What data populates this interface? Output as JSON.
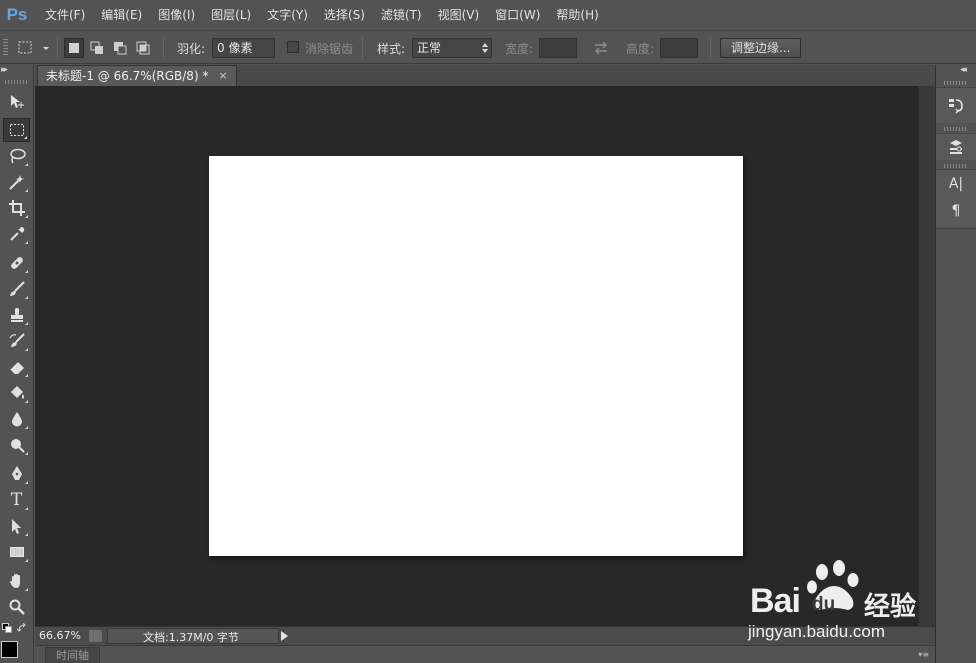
{
  "app": {
    "logo": "Ps"
  },
  "menu": [
    "文件(F)",
    "编辑(E)",
    "图像(I)",
    "图层(L)",
    "文字(Y)",
    "选择(S)",
    "滤镜(T)",
    "视图(V)",
    "窗口(W)",
    "帮助(H)"
  ],
  "options": {
    "feather_label": "羽化:",
    "feather_value": "0 像素",
    "antialias_label": "消除锯齿",
    "style_label": "样式:",
    "style_value": "正常",
    "width_label": "宽度:",
    "height_label": "高度:",
    "refine_button": "调整边缘..."
  },
  "document": {
    "tab_title": "未标题-1 @ 66.7%(RGB/8) *",
    "close_glyph": "×"
  },
  "status": {
    "zoom": "66.67%",
    "doc_info": "文档:1.37M/0 字节"
  },
  "timeline": {
    "tab_label": "时间轴"
  },
  "right_panel": {
    "type_icon_label": "A|",
    "paragraph_icon_label": "¶"
  },
  "tools": {
    "type_tool_label": "T"
  },
  "watermark": {
    "brand_1": "Bai",
    "brand_1b": "du",
    "brand_2": "经验",
    "url": "jingyan.baidu.com"
  },
  "colors": {
    "foreground": "#000000",
    "canvas": "#ffffff",
    "workspace": "#282828",
    "accent": "#5fa8e8"
  }
}
